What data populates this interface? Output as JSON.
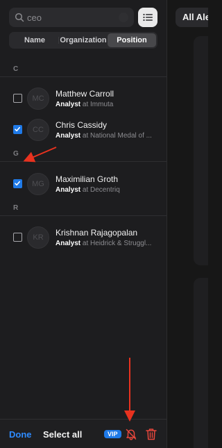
{
  "search": {
    "value": "ceo"
  },
  "tabs": [
    {
      "label": "Name",
      "active": false
    },
    {
      "label": "Organization",
      "active": false
    },
    {
      "label": "Position",
      "active": true
    }
  ],
  "sections": [
    {
      "letter": "C",
      "contacts": [
        {
          "initials": "MC",
          "name": "Matthew Carroll",
          "role": "Analyst",
          "org_text": "at Immuta",
          "checked": false
        },
        {
          "initials": "CC",
          "name": "Chris Cassidy",
          "role": "Analyst",
          "org_text": "at National Medal of ...",
          "checked": true
        }
      ]
    },
    {
      "letter": "G",
      "contacts": [
        {
          "initials": "MG",
          "name": "Maximilian Groth",
          "role": "Analyst",
          "org_text": "at Decentriq",
          "checked": true
        }
      ]
    },
    {
      "letter": "R",
      "contacts": [
        {
          "initials": "KR",
          "name": "Krishnan Rajagopalan",
          "role": "Analyst",
          "org_text": "at Heidrick & Struggl...",
          "checked": false
        }
      ]
    }
  ],
  "bottom": {
    "done": "Done",
    "select_all": "Select all",
    "vip": "VIP"
  },
  "right": {
    "tab_label": "All Alerts"
  },
  "colors": {
    "accent_blue": "#1f7ae8",
    "danger_red": "#e8473c",
    "annotation_arrow": "#e8321f"
  },
  "icons": [
    "search-icon",
    "list-view-icon",
    "checkmark-icon",
    "bell-slash-icon",
    "trash-icon",
    "arrow-annotation"
  ]
}
